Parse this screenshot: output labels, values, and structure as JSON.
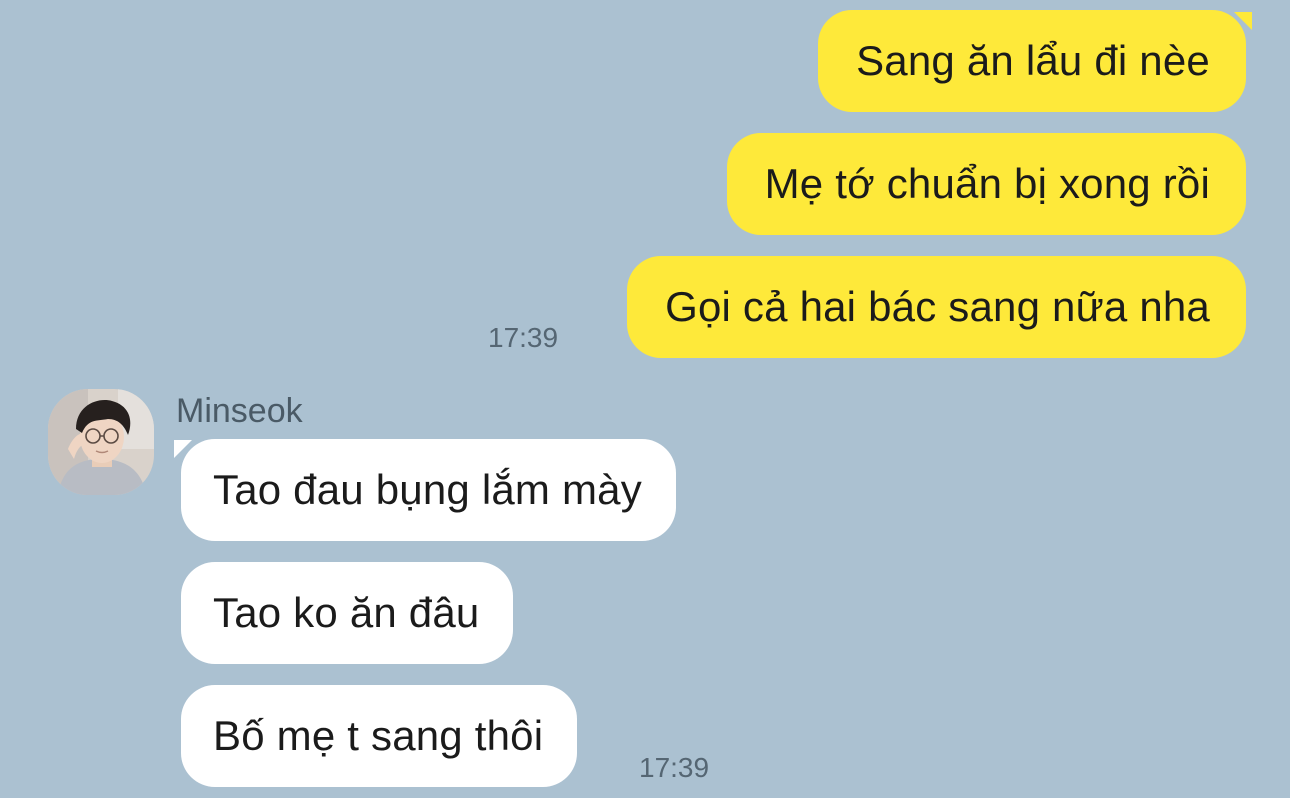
{
  "colors": {
    "background": "#abc1d1",
    "outgoing_bubble": "#fee93a",
    "incoming_bubble": "#ffffff",
    "text": "#1b1b1b",
    "timestamp": "#556673"
  },
  "outgoing": {
    "messages": [
      "Sang ăn lẩu đi nèe",
      "Mẹ tớ chuẩn bị xong rồi",
      "Gọi cả hai bác sang nữa nha"
    ],
    "time": "17:39"
  },
  "incoming": {
    "sender": "Minseok",
    "avatar_icon": "profile-photo-avatar",
    "messages": [
      "Tao đau bụng lắm mày",
      "Tao ko ăn đâu",
      "Bố mẹ t sang thôi"
    ],
    "time": "17:39"
  }
}
